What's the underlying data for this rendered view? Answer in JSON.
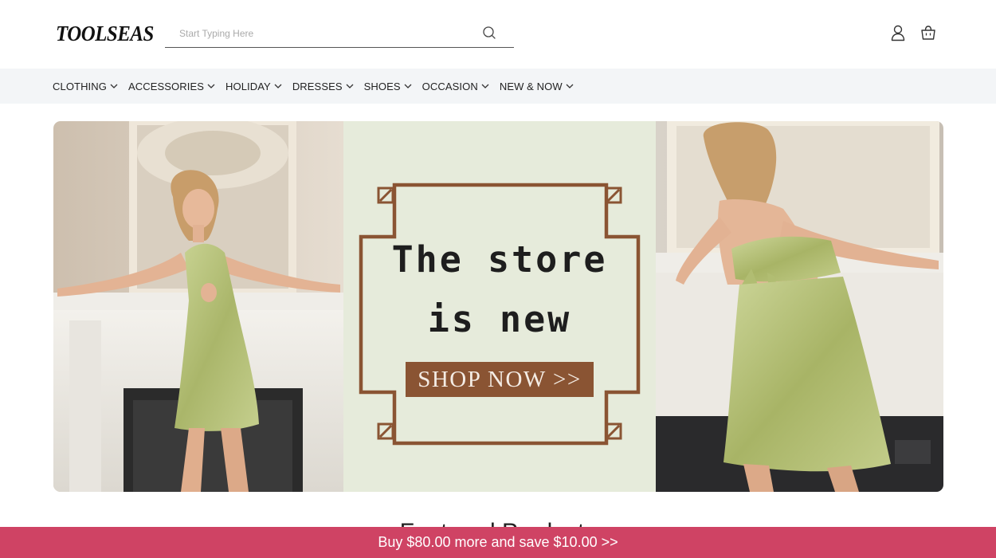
{
  "header": {
    "logo": "TOOLSEAS",
    "search": {
      "placeholder": "Start Typing Here",
      "value": ""
    },
    "icons": [
      "search-icon",
      "user-icon",
      "shopping-bag-icon"
    ]
  },
  "nav": {
    "items": [
      {
        "label": "CLOTHING"
      },
      {
        "label": "ACCESSORIES"
      },
      {
        "label": "HOLIDAY"
      },
      {
        "label": "DRESSES"
      },
      {
        "label": "SHOES"
      },
      {
        "label": "OCCASION"
      },
      {
        "label": "NEW & NOW"
      }
    ]
  },
  "hero": {
    "line1": "The store",
    "line2": "is new",
    "cta": "SHOP NOW >>"
  },
  "featured": {
    "title": "Featured Products"
  },
  "promo": {
    "text": "Buy $80.00 more and save $10.00  >>"
  },
  "colors": {
    "promo_bg": "#cf4364",
    "nav_bg": "#f3f5f7",
    "hero_mid_bg": "#e6ebdb",
    "hero_frame": "#8a5433",
    "dress": "#b9c57d"
  }
}
